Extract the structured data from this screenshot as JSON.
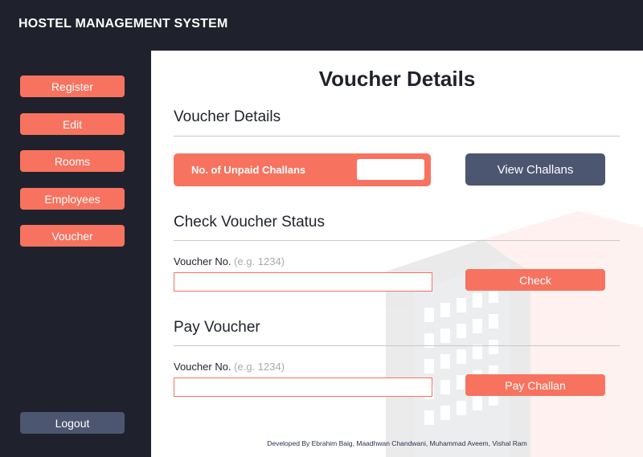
{
  "app": {
    "title": "HOSTEL MANAGEMENT SYSTEM"
  },
  "sidebar": {
    "items": [
      {
        "label": "Register"
      },
      {
        "label": "Edit"
      },
      {
        "label": "Rooms"
      },
      {
        "label": "Employees"
      },
      {
        "label": "Voucher"
      }
    ],
    "logout_label": "Logout"
  },
  "page": {
    "title": "Voucher Details"
  },
  "voucher_details": {
    "heading": "Voucher Details",
    "unpaid_label": "No. of Unpaid Challans",
    "unpaid_value": "",
    "view_button": "View Challans"
  },
  "check_status": {
    "heading": "Check Voucher Status",
    "field_label": "Voucher No.",
    "field_hint": "(e.g. 1234)",
    "value": "",
    "button": "Check"
  },
  "pay_voucher": {
    "heading": "Pay Voucher",
    "field_label": "Voucher No.",
    "field_hint": "(e.g. 1234)",
    "value": "",
    "button": "Pay Challan"
  },
  "footer": {
    "text": "Developed By Ebrahim Baig, Maadhwan Chandwani, Muhammad Aveem, Vishal Ram"
  },
  "colors": {
    "accent": "#f7735f",
    "dark": "#1f222c",
    "slate": "#4d5670"
  }
}
